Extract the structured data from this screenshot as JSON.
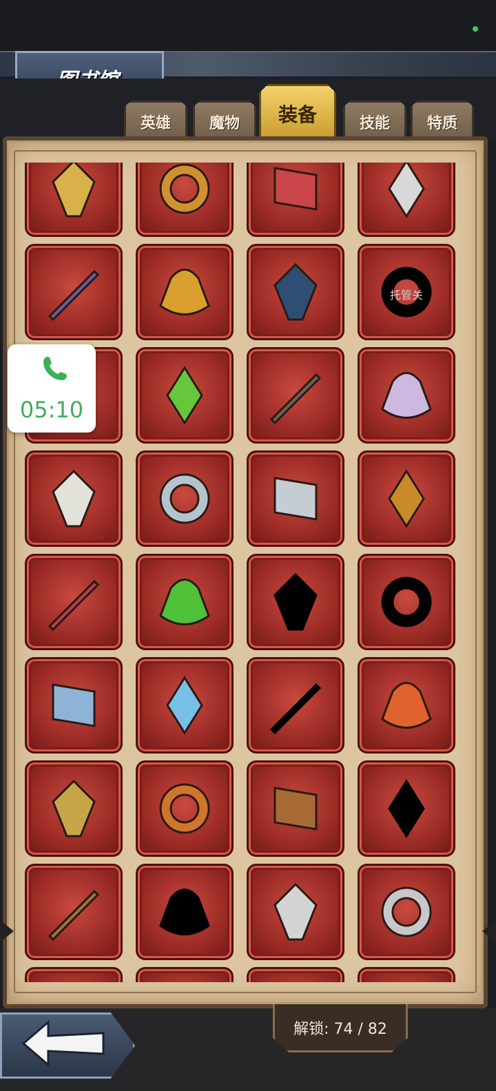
{
  "header": {
    "title": "图书馆"
  },
  "tabs": [
    {
      "label": "英雄",
      "active": false
    },
    {
      "label": "魔物",
      "active": false
    },
    {
      "label": "装备",
      "active": true
    },
    {
      "label": "技能",
      "active": false
    },
    {
      "label": "特质",
      "active": false
    }
  ],
  "grid": {
    "items": [
      {
        "name": "golden-winged-helmet",
        "locked": false,
        "color": "#d8b14a"
      },
      {
        "name": "purple-gem-ring",
        "locked": false,
        "color": "#d09230"
      },
      {
        "name": "jeweled-spellbook",
        "locked": false,
        "color": "#c9454a"
      },
      {
        "name": "ruby-amulet",
        "locked": false,
        "color": "#d8d8d8"
      },
      {
        "name": "gemmed-cross-scepter",
        "locked": false,
        "color": "#6b5aa3"
      },
      {
        "name": "multi-gem-crown-ring",
        "locked": false,
        "color": "#d9a030"
      },
      {
        "name": "plague-mask",
        "locked": false,
        "color": "#2f4e73"
      },
      {
        "name": "shadow-item",
        "locked": true,
        "color": "#000000"
      },
      {
        "name": "hidden-item",
        "locked": false,
        "color": "#7d2c5e"
      },
      {
        "name": "venom-bow",
        "locked": false,
        "color": "#67c73c"
      },
      {
        "name": "stone-warhammer",
        "locked": false,
        "color": "#6b6157"
      },
      {
        "name": "crystal-greatsword",
        "locked": false,
        "color": "#cdb8e0"
      },
      {
        "name": "poison-dagger",
        "locked": false,
        "color": "#e2e2da"
      },
      {
        "name": "bone-scythe",
        "locked": false,
        "color": "#b4c4cf"
      },
      {
        "name": "silver-spear",
        "locked": false,
        "color": "#c6ccd4"
      },
      {
        "name": "lightning-spear",
        "locked": false,
        "color": "#c98b2a"
      },
      {
        "name": "crimson-battleaxe",
        "locked": false,
        "color": "#bc3b55"
      },
      {
        "name": "emerald-blade",
        "locked": false,
        "color": "#4fc23a"
      },
      {
        "name": "shadow-weapon",
        "locked": true,
        "color": "#000000"
      },
      {
        "name": "shadow-greatsword",
        "locked": true,
        "color": "#000000"
      },
      {
        "name": "skull-staff",
        "locked": false,
        "color": "#8fb3d6"
      },
      {
        "name": "crystal-orb-ring",
        "locked": false,
        "color": "#79c0e8"
      },
      {
        "name": "shadow-orb",
        "locked": true,
        "color": "#000000"
      },
      {
        "name": "molten-heart",
        "locked": false,
        "color": "#e0622c"
      },
      {
        "name": "spiked-shield",
        "locked": false,
        "color": "#c7a64a"
      },
      {
        "name": "pumpkin-ring",
        "locked": false,
        "color": "#d0762c"
      },
      {
        "name": "horned-mask",
        "locked": false,
        "color": "#a86a35"
      },
      {
        "name": "shadow-helm",
        "locked": true,
        "color": "#000000"
      },
      {
        "name": "brass-goggles",
        "locked": false,
        "color": "#a07042"
      },
      {
        "name": "shadow-pouch",
        "locked": true,
        "color": "#000000"
      },
      {
        "name": "silver-whistle",
        "locked": false,
        "color": "#d4d4d4"
      },
      {
        "name": "steel-bracer",
        "locked": false,
        "color": "#c8c8cc"
      },
      {
        "name": "partial-item-1",
        "locked": false,
        "color": "#b04a3a"
      },
      {
        "name": "partial-item-2",
        "locked": false,
        "color": "#b04a3a"
      },
      {
        "name": "partial-item-3",
        "locked": false,
        "color": "#b04a3a"
      },
      {
        "name": "partial-item-4",
        "locked": false,
        "color": "#b04a3a"
      }
    ],
    "locked_caption": "托管关"
  },
  "call": {
    "time": "05:10"
  },
  "footer": {
    "unlock_text": "解锁: 74 / 82"
  }
}
